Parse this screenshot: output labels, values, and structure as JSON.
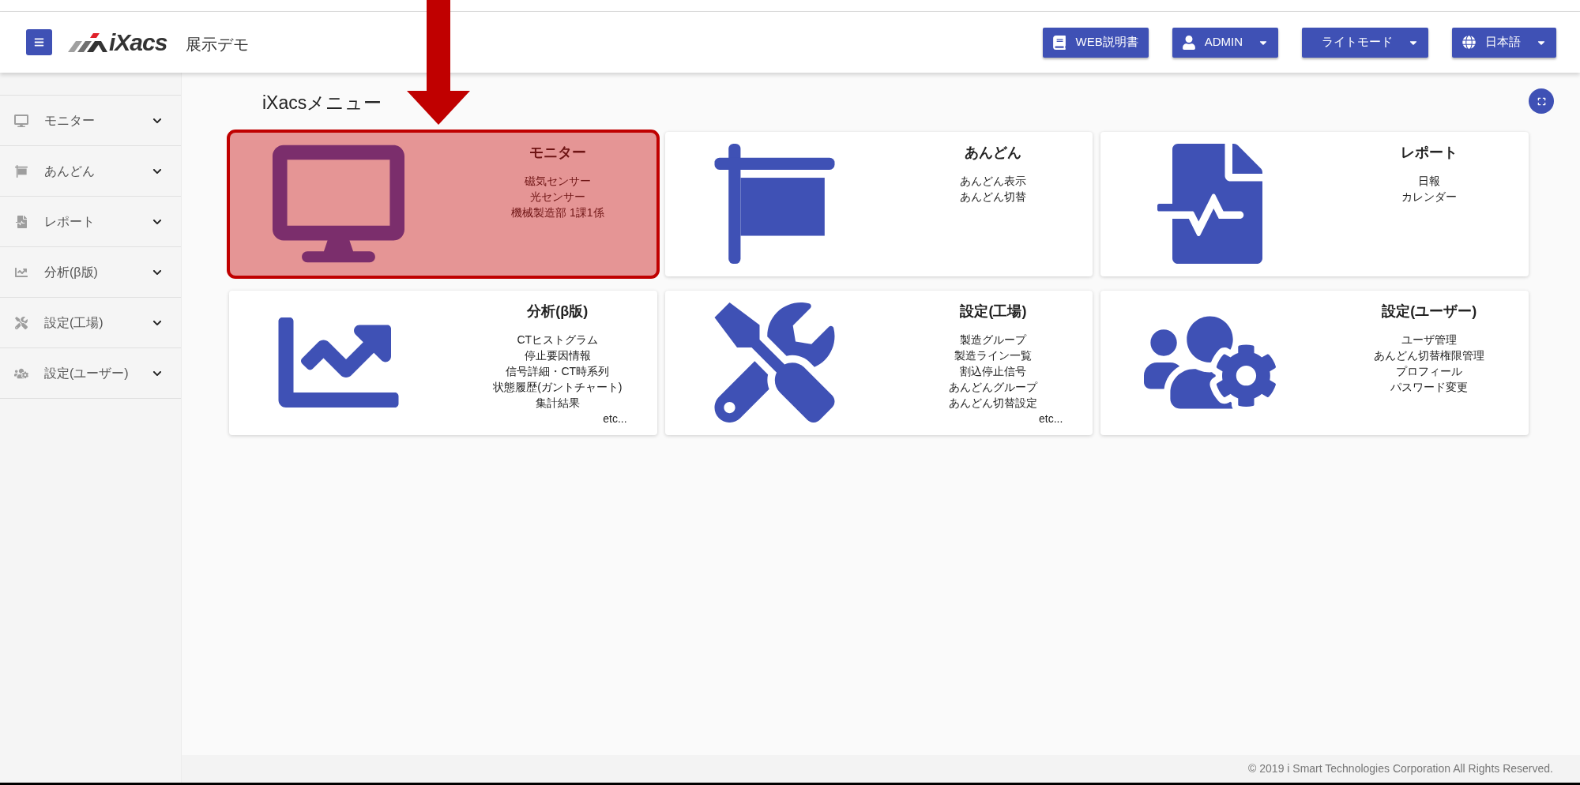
{
  "header": {
    "brand": "iXacs",
    "site": "展示デモ",
    "buttons": [
      {
        "kind": "book",
        "label": "WEB説明書",
        "dropdown": false
      },
      {
        "kind": "user",
        "label": "ADMIN",
        "dropdown": true
      },
      {
        "kind": "plain",
        "label": "ライトモード",
        "dropdown": true
      },
      {
        "kind": "globe",
        "label": "日本語",
        "dropdown": true
      }
    ]
  },
  "sidebar": {
    "items": [
      {
        "label": "モニター",
        "expanded": false
      },
      {
        "label": "あんどん",
        "expanded": false
      },
      {
        "label": "レポート",
        "expanded": false
      },
      {
        "label": "分析(β版)",
        "expanded": false
      },
      {
        "label": "設定(工場)",
        "expanded": false
      },
      {
        "label": "設定(ユーザー)",
        "expanded": false
      }
    ]
  },
  "main": {
    "title": "iXacsメニュー",
    "cards": [
      {
        "title": "モニター",
        "items": [
          "磁気センサー",
          "光センサー",
          "機械製造部 1課1係"
        ],
        "highlighted": true
      },
      {
        "title": "あんどん",
        "items": [
          "あんどん表示",
          "あんどん切替"
        ],
        "highlighted": false
      },
      {
        "title": "レポート",
        "items": [
          "日報",
          "カレンダー"
        ],
        "highlighted": false
      },
      {
        "title": "分析(β版)",
        "items": [
          "CTヒストグラム",
          "停止要因情報",
          "信号詳細・CT時系列",
          "状態履歴(ガントチャート)",
          "集計結果"
        ],
        "more": "etc...",
        "highlighted": false
      },
      {
        "title": "設定(工場)",
        "items": [
          "製造グループ",
          "製造ライン一覧",
          "割込停止信号",
          "あんどんグループ",
          "あんどん切替設定"
        ],
        "more": "etc...",
        "highlighted": false
      },
      {
        "title": "設定(ユーザー)",
        "items": [
          "ユーザ管理",
          "あんどん切替権限管理",
          "プロフィール",
          "パスワード変更"
        ],
        "highlighted": false
      }
    ]
  },
  "footer": "© 2019 i Smart Technologies Corporation All Rights Reserved."
}
